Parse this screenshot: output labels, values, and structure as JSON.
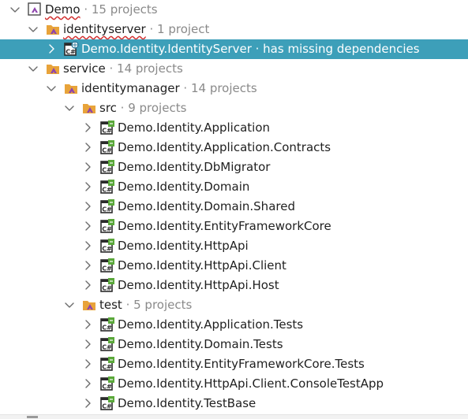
{
  "tree": {
    "rows": [
      {
        "name": "Demo",
        "suffix": " · 15 projects",
        "icon": "solution-icon",
        "chevron": "down",
        "depth": 0,
        "squiggle": true,
        "selected": false
      },
      {
        "name": "identityserver",
        "suffix": " · 1 project",
        "icon": "solution-folder-icon",
        "chevron": "down",
        "depth": 1,
        "squiggle": true,
        "selected": false
      },
      {
        "name": "Demo.Identity.IdentityServer",
        "suffix": " · has missing dependencies",
        "icon": "csharp-web-project-icon",
        "chevron": "right",
        "depth": 2,
        "squiggle": false,
        "selected": true
      },
      {
        "name": "service",
        "suffix": " · 14 projects",
        "icon": "solution-folder-icon",
        "chevron": "down",
        "depth": 1,
        "squiggle": false,
        "selected": false
      },
      {
        "name": "identitymanager",
        "suffix": " · 14 projects",
        "icon": "solution-folder-icon",
        "chevron": "down",
        "depth": 2,
        "squiggle": false,
        "selected": false
      },
      {
        "name": "src",
        "suffix": " · 9 projects",
        "icon": "solution-folder-icon",
        "chevron": "down",
        "depth": 3,
        "squiggle": false,
        "selected": false
      },
      {
        "name": "Demo.Identity.Application",
        "suffix": "",
        "icon": "csharp-project-icon",
        "chevron": "right",
        "depth": 4,
        "squiggle": false,
        "selected": false
      },
      {
        "name": "Demo.Identity.Application.Contracts",
        "suffix": "",
        "icon": "csharp-project-icon",
        "chevron": "right",
        "depth": 4,
        "squiggle": false,
        "selected": false
      },
      {
        "name": "Demo.Identity.DbMigrator",
        "suffix": "",
        "icon": "csharp-project-icon",
        "chevron": "right",
        "depth": 4,
        "squiggle": false,
        "selected": false
      },
      {
        "name": "Demo.Identity.Domain",
        "suffix": "",
        "icon": "csharp-project-icon",
        "chevron": "right",
        "depth": 4,
        "squiggle": false,
        "selected": false
      },
      {
        "name": "Demo.Identity.Domain.Shared",
        "suffix": "",
        "icon": "csharp-project-icon",
        "chevron": "right",
        "depth": 4,
        "squiggle": false,
        "selected": false
      },
      {
        "name": "Demo.Identity.EntityFrameworkCore",
        "suffix": "",
        "icon": "csharp-project-icon",
        "chevron": "right",
        "depth": 4,
        "squiggle": false,
        "selected": false
      },
      {
        "name": "Demo.Identity.HttpApi",
        "suffix": "",
        "icon": "csharp-project-icon",
        "chevron": "right",
        "depth": 4,
        "squiggle": false,
        "selected": false
      },
      {
        "name": "Demo.Identity.HttpApi.Client",
        "suffix": "",
        "icon": "csharp-project-icon",
        "chevron": "right",
        "depth": 4,
        "squiggle": false,
        "selected": false
      },
      {
        "name": "Demo.Identity.HttpApi.Host",
        "suffix": "",
        "icon": "csharp-project-icon",
        "chevron": "right",
        "depth": 4,
        "squiggle": false,
        "selected": false
      },
      {
        "name": "test",
        "suffix": " · 5 projects",
        "icon": "solution-folder-icon",
        "chevron": "down",
        "depth": 3,
        "squiggle": false,
        "selected": false
      },
      {
        "name": "Demo.Identity.Application.Tests",
        "suffix": "",
        "icon": "csharp-project-icon",
        "chevron": "right",
        "depth": 4,
        "squiggle": false,
        "selected": false
      },
      {
        "name": "Demo.Identity.Domain.Tests",
        "suffix": "",
        "icon": "csharp-project-icon",
        "chevron": "right",
        "depth": 4,
        "squiggle": false,
        "selected": false
      },
      {
        "name": "Demo.Identity.EntityFrameworkCore.Tests",
        "suffix": "",
        "icon": "csharp-project-icon",
        "chevron": "right",
        "depth": 4,
        "squiggle": false,
        "selected": false
      },
      {
        "name": "Demo.Identity.HttpApi.Client.ConsoleTestApp",
        "suffix": "",
        "icon": "csharp-project-icon",
        "chevron": "right",
        "depth": 4,
        "squiggle": false,
        "selected": false
      },
      {
        "name": "Demo.Identity.TestBase",
        "suffix": "",
        "icon": "csharp-project-icon",
        "chevron": "right",
        "depth": 4,
        "squiggle": false,
        "selected": false
      }
    ]
  },
  "colors": {
    "selection": "#3d9fb9",
    "folder_orange": "#e8a33a",
    "vs_purple": "#8e44ad",
    "project_green": "#5aa83a",
    "suffix_gray": "#8a8a8a"
  }
}
